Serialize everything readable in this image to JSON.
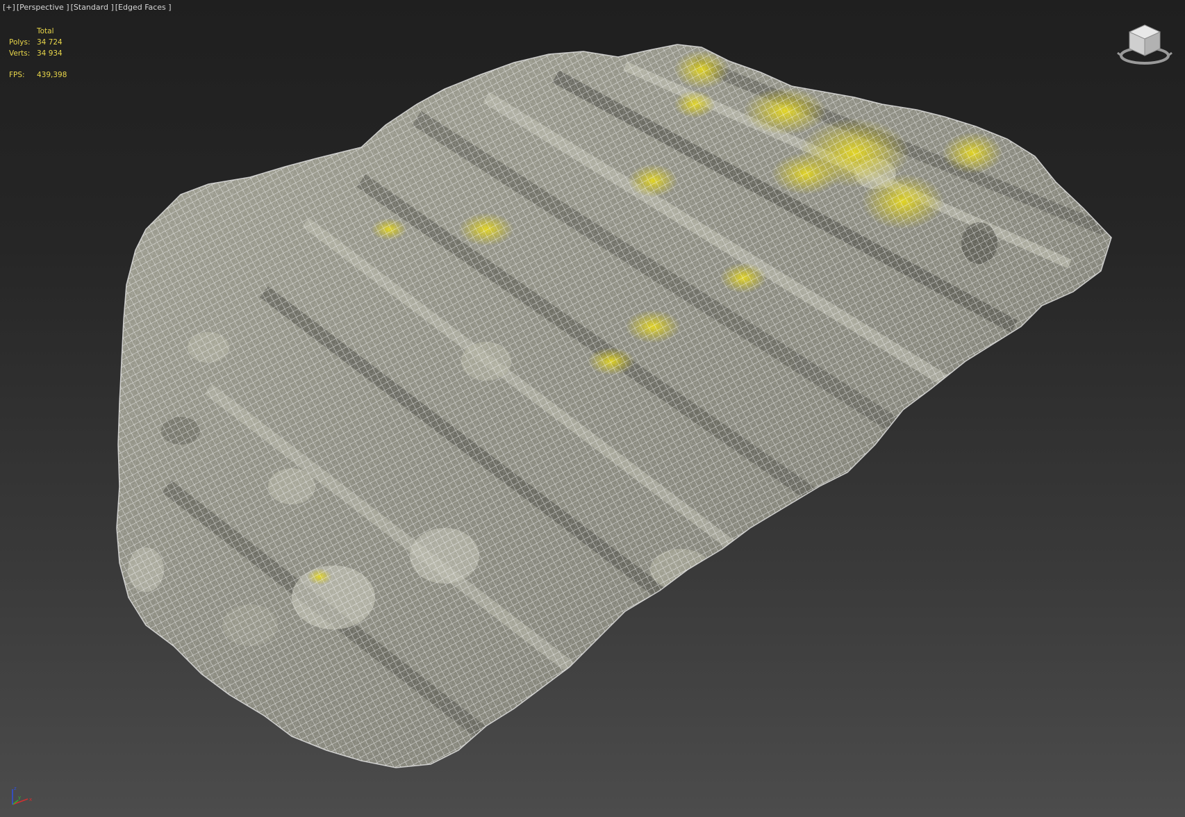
{
  "viewport": {
    "labels": [
      "[+]",
      "[Perspective ]",
      "[Standard ]",
      "[Edged Faces ]"
    ]
  },
  "stats": {
    "header": "Total",
    "polys_label": "Polys:",
    "polys_value": "34 724",
    "verts_label": "Verts:",
    "verts_value": "34 934",
    "fps_label": "FPS:",
    "fps_value": "439,398"
  },
  "colors": {
    "stats_text": "#e8d64a",
    "label_text": "#d6d6d6",
    "rock_base": "#9a9a8e",
    "lichen": "#d8c81e",
    "wireframe": "#f2f2f2"
  },
  "icons": {
    "viewcube": "viewcube-icon",
    "axis": "axis-tripod-icon"
  }
}
